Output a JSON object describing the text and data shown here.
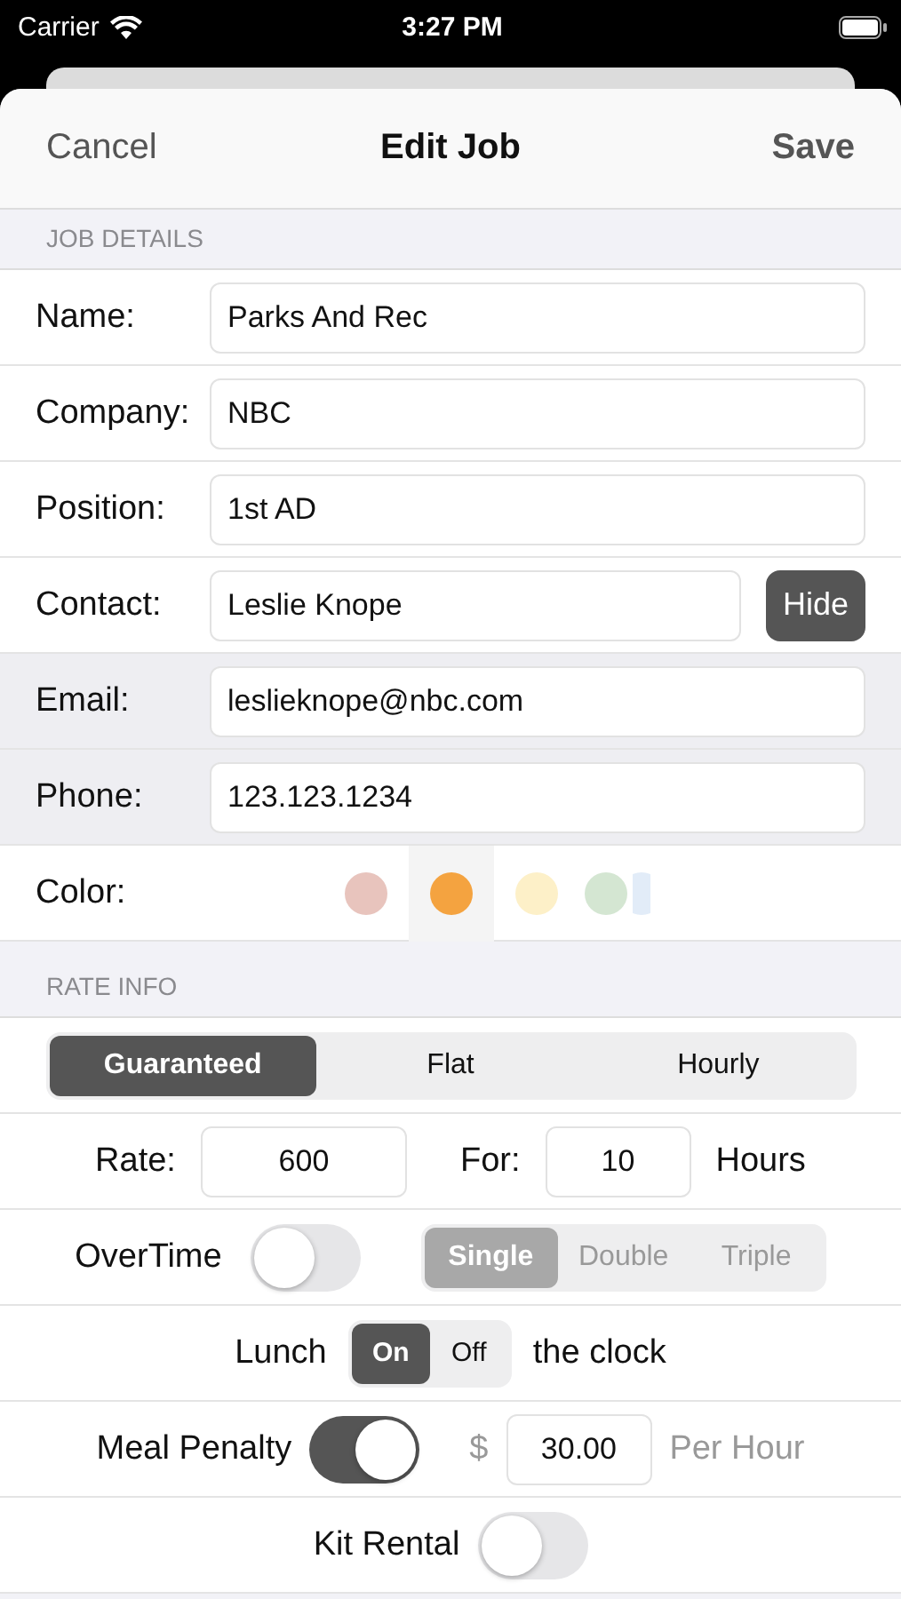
{
  "status_bar": {
    "carrier": "Carrier",
    "time": "3:27 PM"
  },
  "nav": {
    "cancel": "Cancel",
    "title": "Edit Job",
    "save": "Save"
  },
  "job_details": {
    "header": "JOB DETAILS",
    "fields": [
      {
        "kind": "text",
        "label": "Name:",
        "value": "Parks And Rec",
        "highlighted": false
      },
      {
        "kind": "text",
        "label": "Company:",
        "value": "NBC",
        "highlighted": false
      },
      {
        "kind": "text",
        "label": "Position:",
        "value": "1st AD",
        "highlighted": false
      },
      {
        "kind": "button",
        "label": "Contact:",
        "value": "Leslie Knope",
        "button": "Hide",
        "highlighted": false
      },
      {
        "kind": "text",
        "label": "Email:",
        "value": "leslieknope@nbc.com",
        "highlighted": true
      },
      {
        "kind": "text",
        "label": "Phone:",
        "value": "123.123.1234",
        "highlighted": true
      }
    ],
    "color": {
      "label": "Color:",
      "swatches": [
        {
          "color": "#e8c4bd",
          "selected": false
        },
        {
          "color": "#f4a340",
          "selected": true
        },
        {
          "color": "#fdf0c8",
          "selected": false
        },
        {
          "color": "#d4e6d2",
          "selected": false
        },
        {
          "color": "#e2ecf8",
          "selected": false
        }
      ]
    }
  },
  "rate_info": {
    "header": "RATE INFO",
    "rate_type": [
      {
        "label": "Guaranteed",
        "selected": true
      },
      {
        "label": "Flat",
        "selected": false
      },
      {
        "label": "Hourly",
        "selected": false
      }
    ],
    "rate": {
      "label": "Rate:",
      "value": "600",
      "for_label": "For:",
      "hours": "10",
      "unit": "Hours"
    },
    "overtime": {
      "label": "OverTime",
      "on": false,
      "disabled": true,
      "options": [
        {
          "label": "Single",
          "selected": true
        },
        {
          "label": "Double",
          "selected": false
        },
        {
          "label": "Triple",
          "selected": false
        }
      ]
    },
    "lunch": {
      "label": "Lunch",
      "suffix": "the clock",
      "options": [
        {
          "label": "On",
          "selected": true
        },
        {
          "label": "Off",
          "selected": false
        }
      ]
    },
    "meal_penalty": {
      "label": "Meal Penalty",
      "on": true,
      "currency": "$",
      "value": "30.00",
      "unit": "Per Hour"
    },
    "kit_rental": {
      "label": "Kit Rental",
      "on": false
    }
  }
}
